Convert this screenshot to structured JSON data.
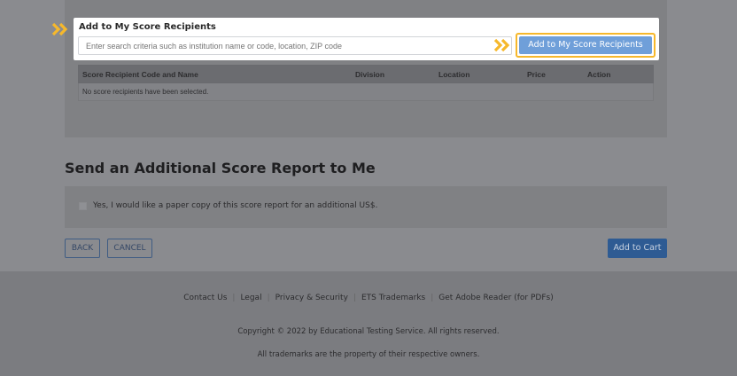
{
  "recipients": {
    "title": "Add to My Score Recipients",
    "search_placeholder": "Enter search criteria such as institution name or code, location, ZIP code",
    "add_button_label": "Add to My Score Recipients",
    "table": {
      "headers": [
        "Score Recipient Code and Name",
        "Division",
        "Location",
        "Price",
        "Action"
      ],
      "empty_message": "No score recipients have been selected."
    }
  },
  "additional": {
    "title": "Send an Additional Score Report to Me",
    "checkbox_label": "Yes, I would like a paper copy of this score report for an additional US$."
  },
  "actions": {
    "back_label": "BACK",
    "cancel_label": "CANCEL",
    "add_to_cart_label": "Add to Cart"
  },
  "footer": {
    "links": [
      "Contact Us",
      "Legal",
      "Privacy & Security",
      "ETS Trademarks",
      "Get Adobe Reader (for PDFs)"
    ],
    "copyright": "Copyright © 2022 by Educational Testing Service. All rights reserved.",
    "trademarks": "All trademarks are the property of their respective owners."
  },
  "icons": {
    "step_arrow": "double-chevron-right-icon"
  },
  "colors": {
    "accent_arrow": "#f6b82b",
    "primary_button": "#6f9fd9",
    "cart_button": "#2e5b93"
  }
}
